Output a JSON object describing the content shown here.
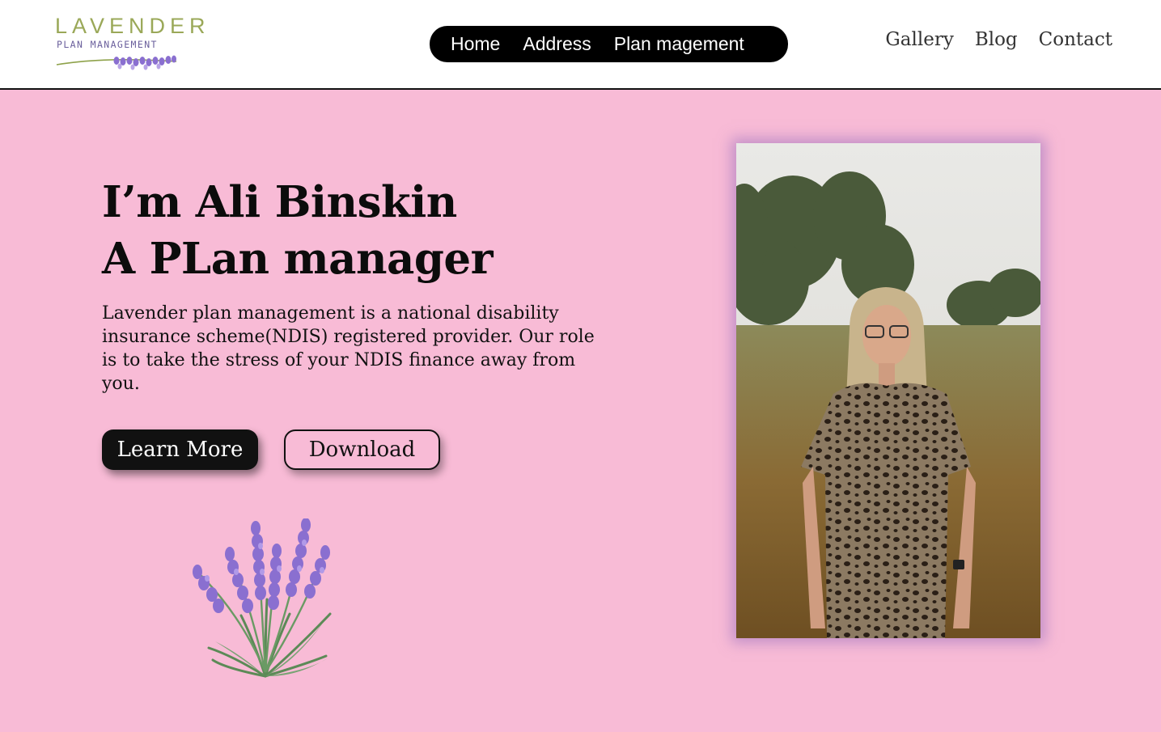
{
  "logo": {
    "word": "LAVENDER",
    "sub": "PLAN MANAGEMENT"
  },
  "nav": {
    "pill_items": [
      "Home",
      "Address",
      "Plan magement"
    ],
    "right_items": [
      "Gallery",
      "Blog",
      "Contact"
    ]
  },
  "hero": {
    "headline_line1": "I’m Ali Binskin",
    "headline_line2": "A PLan manager",
    "intro": "Lavender plan management is a national disability insurance scheme(NDIS) registered provider. Our role is to take the stress of your NDIS finance away from you.",
    "learn_more_label": "Learn More",
    "download_label": "Download"
  },
  "colors": {
    "hero_bg": "#f8bbd6",
    "logo_green": "#9aa858",
    "logo_purple": "#6a5f9c",
    "lavender": "#8a6fd0",
    "nav_pill": "#000000",
    "photo_glow": "#a07ac8"
  },
  "icons": [
    "lavender-sprig-icon",
    "lavender-bouquet-icon"
  ]
}
